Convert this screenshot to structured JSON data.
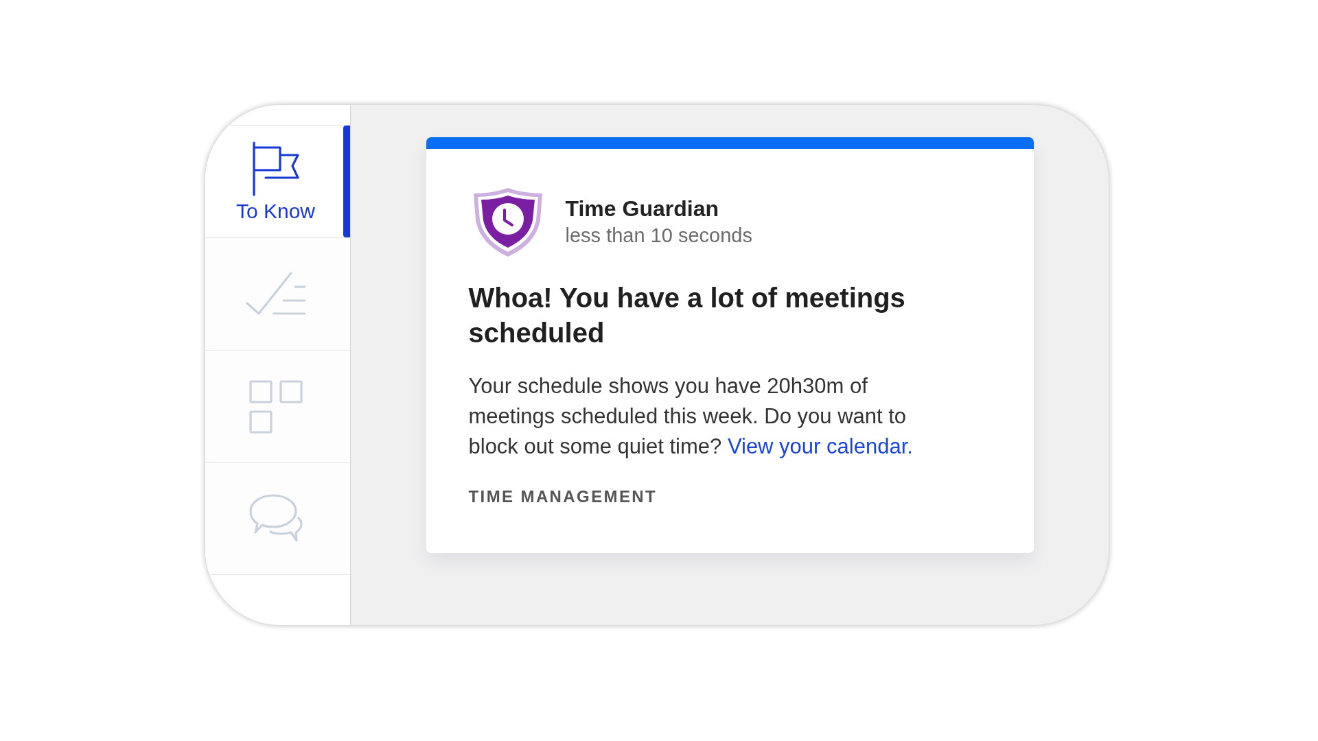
{
  "sidebar": {
    "items": [
      {
        "label": "To Know",
        "selected": true
      },
      {
        "selected": false
      },
      {
        "selected": false
      },
      {
        "selected": false
      }
    ]
  },
  "card": {
    "source": {
      "name": "Time Guardian",
      "time": "less than 10 seconds"
    },
    "title": "Whoa! You have a lot of meetings scheduled",
    "body": {
      "text": "Your schedule shows you have 20h30m of meetings scheduled this week. Do you want to block out some quiet time?",
      "link": "View your calendar."
    },
    "tag": "TIME MANAGEMENT"
  }
}
